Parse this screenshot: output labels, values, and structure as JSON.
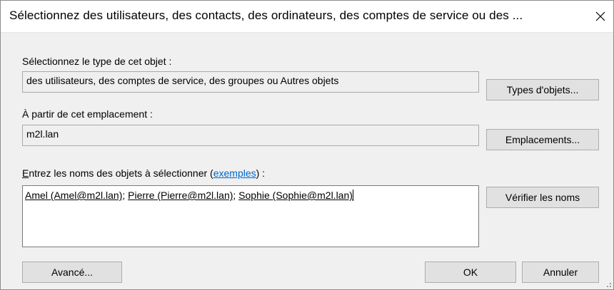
{
  "dialog": {
    "title": "Sélectionnez des utilisateurs, des contacts, des ordinateurs, des comptes de service ou des ..."
  },
  "object_type": {
    "label": "Sélectionnez le type de cet objet :",
    "value": "des utilisateurs, des comptes de service, des groupes ou Autres objets",
    "button": "Types d'objets..."
  },
  "location": {
    "label": "À partir de cet emplacement :",
    "value": "m2l.lan",
    "button": "Emplacements..."
  },
  "names": {
    "label_prefix_underlined": "E",
    "label_prefix": "ntrez les noms des objets à sélectionner (",
    "examples_link": "exemples",
    "label_suffix": ") :",
    "entries": [
      {
        "text": "Amel (Amel@m2l.lan)",
        "sep": "; "
      },
      {
        "text": "Pierre (Pierre@m2l.lan)",
        "sep": "; "
      },
      {
        "text": "Sophie (Sophie@m2l.lan)",
        "sep": ""
      }
    ],
    "check_button": "Vérifier les noms"
  },
  "footer": {
    "advanced_button": "Avancé...",
    "ok_button": "OK",
    "cancel_button": "Annuler"
  },
  "icons": {
    "close": "close-icon",
    "resize": "resize-grip-icon"
  }
}
